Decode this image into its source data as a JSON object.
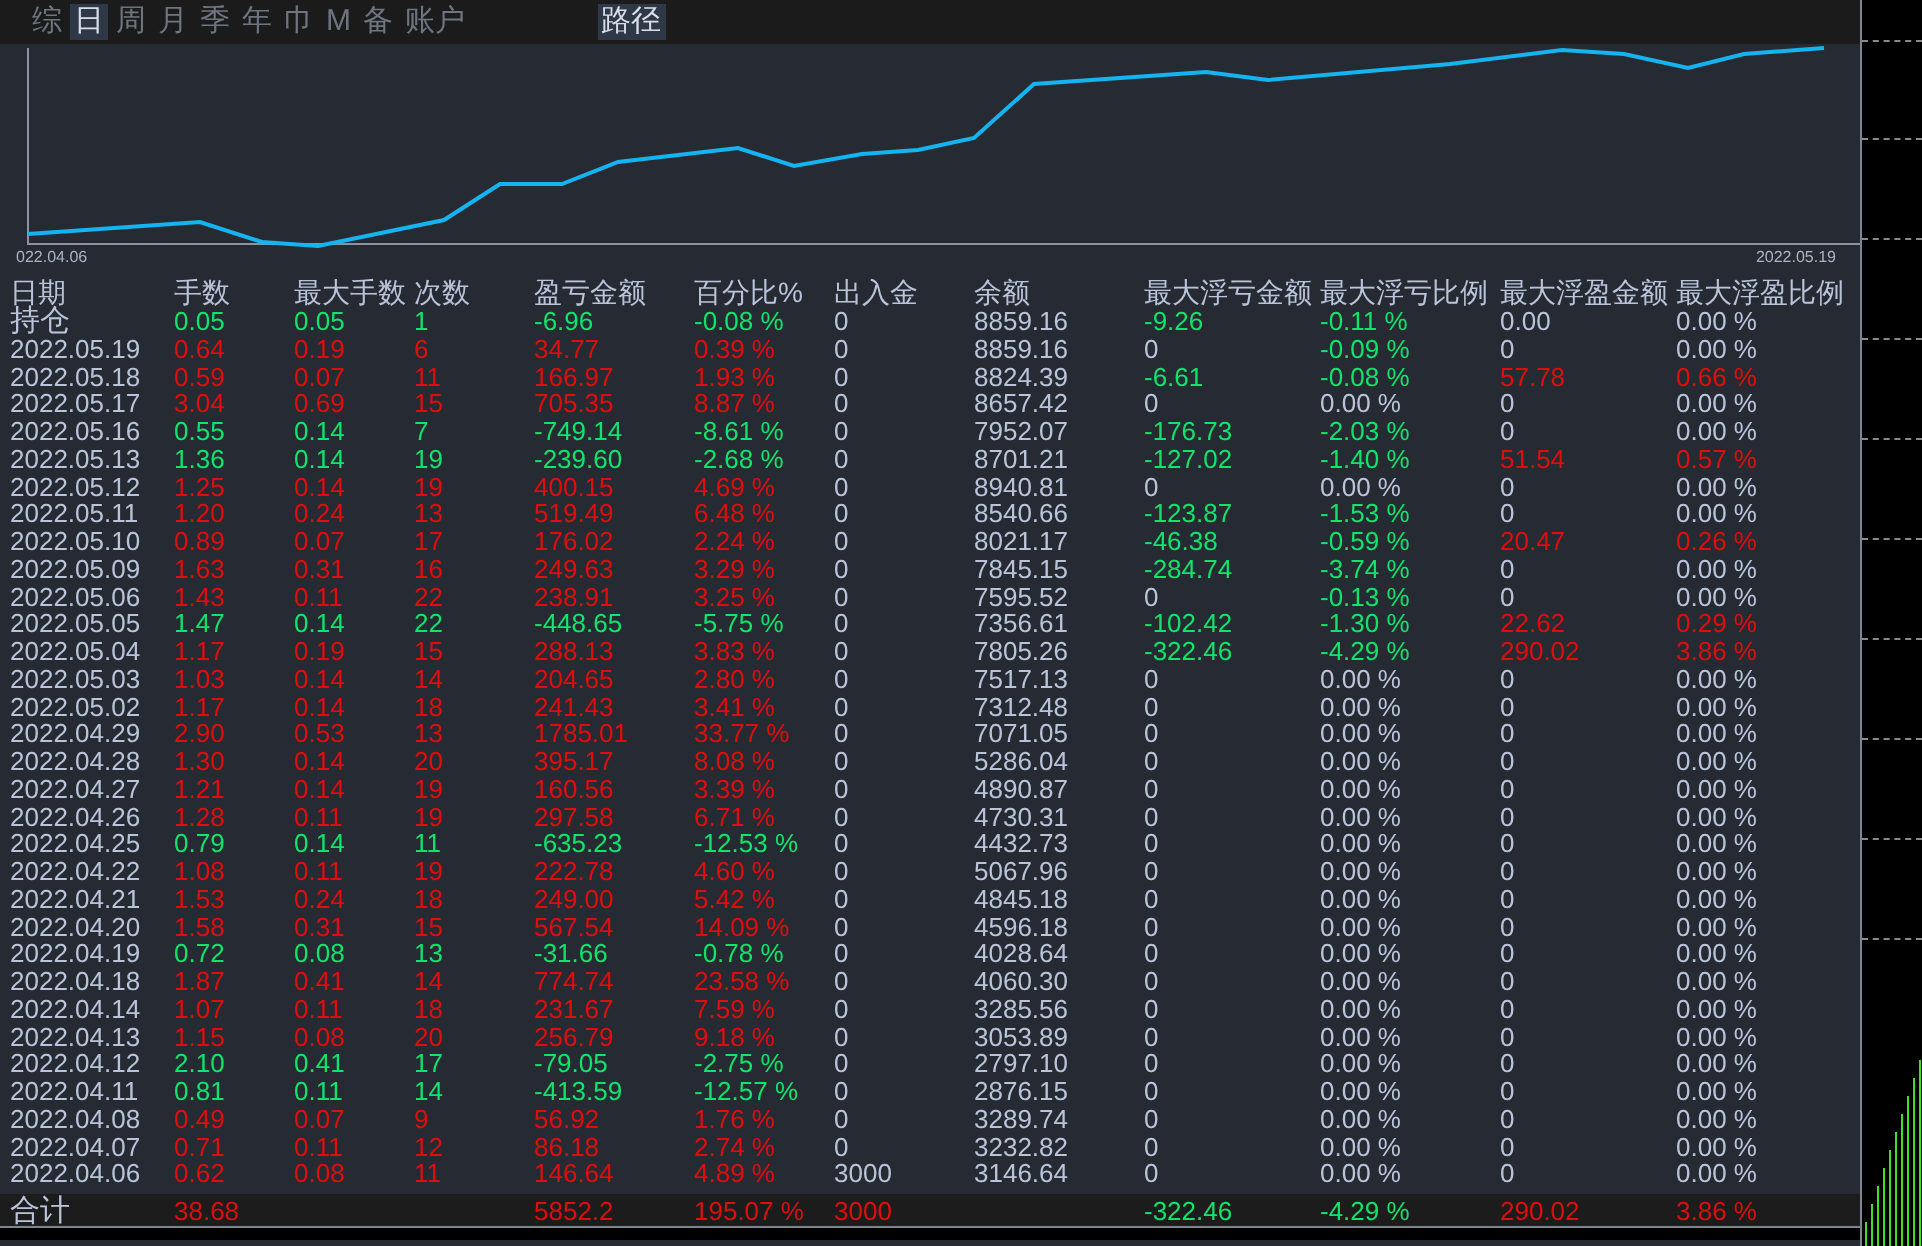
{
  "tabs": [
    {
      "label": "综",
      "selected": false
    },
    {
      "label": "日",
      "selected": true
    },
    {
      "label": "周",
      "selected": false
    },
    {
      "label": "月",
      "selected": false
    },
    {
      "label": "季",
      "selected": false
    },
    {
      "label": "年",
      "selected": false
    },
    {
      "label": "巾",
      "selected": false
    },
    {
      "label": "M",
      "selected": false
    },
    {
      "label": "备",
      "selected": false
    },
    {
      "label": "账户",
      "selected": false
    }
  ],
  "path_tab": {
    "label": "路径",
    "selected": true
  },
  "chart": {
    "start_label": "022.04.06",
    "end_label": "2022.05.19"
  },
  "table": {
    "columns": [
      "日期",
      "手数",
      "最大手数",
      "次数",
      "盈亏金额",
      "百分比%",
      "出入金",
      "余额",
      "最大浮亏金额",
      "最大浮亏比例",
      "最大浮盈金额",
      "最大浮盈比例"
    ],
    "rows": [
      {
        "kind": "position",
        "date": "持仓",
        "color": "#11e46a",
        "lots": "0.05",
        "max_lots": "0.05",
        "count": "1",
        "pnl": "-6.96",
        "percent": "-0.08 %",
        "transfer": "0",
        "balance": "8859.16",
        "float": [
          {
            "text": "-9.26",
            "color": "#11e46a"
          },
          {
            "text": "-0.11 %",
            "color": "#11e46a"
          },
          {
            "text": "0.00",
            "color": "#b9c4da"
          },
          {
            "text": "0.00 %",
            "color": "#b9c4da"
          }
        ]
      },
      {
        "kind": "day",
        "date": "2022.05.19",
        "color": "#e00d0d",
        "lots": "0.64",
        "max_lots": "0.19",
        "count": "6",
        "pnl": "34.77",
        "percent": "0.39 %",
        "transfer": "0",
        "balance": "8859.16",
        "float": [
          {
            "text": "0",
            "color": "#b9c4da"
          },
          {
            "text": "-0.09 %",
            "color": "#11e46a"
          },
          {
            "text": "0",
            "color": "#b9c4da"
          },
          {
            "text": "0.00 %",
            "color": "#b9c4da"
          }
        ]
      },
      {
        "kind": "day",
        "date": "2022.05.18",
        "color": "#e00d0d",
        "lots": "0.59",
        "max_lots": "0.07",
        "count": "11",
        "pnl": "166.97",
        "percent": "1.93 %",
        "transfer": "0",
        "balance": "8824.39",
        "float": [
          {
            "text": "-6.61",
            "color": "#11e46a"
          },
          {
            "text": "-0.08 %",
            "color": "#11e46a"
          },
          {
            "text": "57.78",
            "color": "#e00d0d"
          },
          {
            "text": "0.66 %",
            "color": "#e00d0d"
          }
        ]
      },
      {
        "kind": "day",
        "date": "2022.05.17",
        "color": "#e00d0d",
        "lots": "3.04",
        "max_lots": "0.69",
        "count": "15",
        "pnl": "705.35",
        "percent": "8.87 %",
        "transfer": "0",
        "balance": "8657.42",
        "float": [
          {
            "text": "0",
            "color": "#b9c4da"
          },
          {
            "text": "0.00 %",
            "color": "#b9c4da"
          },
          {
            "text": "0",
            "color": "#b9c4da"
          },
          {
            "text": "0.00 %",
            "color": "#b9c4da"
          }
        ]
      },
      {
        "kind": "day",
        "date": "2022.05.16",
        "color": "#11e46a",
        "lots": "0.55",
        "max_lots": "0.14",
        "count": "7",
        "pnl": "-749.14",
        "percent": "-8.61 %",
        "transfer": "0",
        "balance": "7952.07",
        "float": [
          {
            "text": "-176.73",
            "color": "#11e46a"
          },
          {
            "text": "-2.03 %",
            "color": "#11e46a"
          },
          {
            "text": "0",
            "color": "#b9c4da"
          },
          {
            "text": "0.00 %",
            "color": "#b9c4da"
          }
        ]
      },
      {
        "kind": "day",
        "date": "2022.05.13",
        "color": "#11e46a",
        "lots": "1.36",
        "max_lots": "0.14",
        "count": "19",
        "pnl": "-239.60",
        "percent": "-2.68 %",
        "transfer": "0",
        "balance": "8701.21",
        "float": [
          {
            "text": "-127.02",
            "color": "#11e46a"
          },
          {
            "text": "-1.40 %",
            "color": "#11e46a"
          },
          {
            "text": "51.54",
            "color": "#e00d0d"
          },
          {
            "text": "0.57 %",
            "color": "#e00d0d"
          }
        ]
      },
      {
        "kind": "day",
        "date": "2022.05.12",
        "color": "#e00d0d",
        "lots": "1.25",
        "max_lots": "0.14",
        "count": "19",
        "pnl": "400.15",
        "percent": "4.69 %",
        "transfer": "0",
        "balance": "8940.81",
        "float": [
          {
            "text": "0",
            "color": "#b9c4da"
          },
          {
            "text": "0.00 %",
            "color": "#b9c4da"
          },
          {
            "text": "0",
            "color": "#b9c4da"
          },
          {
            "text": "0.00 %",
            "color": "#b9c4da"
          }
        ]
      },
      {
        "kind": "day",
        "date": "2022.05.11",
        "color": "#e00d0d",
        "lots": "1.20",
        "max_lots": "0.24",
        "count": "13",
        "pnl": "519.49",
        "percent": "6.48 %",
        "transfer": "0",
        "balance": "8540.66",
        "float": [
          {
            "text": "-123.87",
            "color": "#11e46a"
          },
          {
            "text": "-1.53 %",
            "color": "#11e46a"
          },
          {
            "text": "0",
            "color": "#b9c4da"
          },
          {
            "text": "0.00 %",
            "color": "#b9c4da"
          }
        ]
      },
      {
        "kind": "day",
        "date": "2022.05.10",
        "color": "#e00d0d",
        "lots": "0.89",
        "max_lots": "0.07",
        "count": "17",
        "pnl": "176.02",
        "percent": "2.24 %",
        "transfer": "0",
        "balance": "8021.17",
        "float": [
          {
            "text": "-46.38",
            "color": "#11e46a"
          },
          {
            "text": "-0.59 %",
            "color": "#11e46a"
          },
          {
            "text": "20.47",
            "color": "#e00d0d"
          },
          {
            "text": "0.26 %",
            "color": "#e00d0d"
          }
        ]
      },
      {
        "kind": "day",
        "date": "2022.05.09",
        "color": "#e00d0d",
        "lots": "1.63",
        "max_lots": "0.31",
        "count": "16",
        "pnl": "249.63",
        "percent": "3.29 %",
        "transfer": "0",
        "balance": "7845.15",
        "float": [
          {
            "text": "-284.74",
            "color": "#11e46a"
          },
          {
            "text": "-3.74 %",
            "color": "#11e46a"
          },
          {
            "text": "0",
            "color": "#b9c4da"
          },
          {
            "text": "0.00 %",
            "color": "#b9c4da"
          }
        ]
      },
      {
        "kind": "day",
        "date": "2022.05.06",
        "color": "#e00d0d",
        "lots": "1.43",
        "max_lots": "0.11",
        "count": "22",
        "pnl": "238.91",
        "percent": "3.25 %",
        "transfer": "0",
        "balance": "7595.52",
        "float": [
          {
            "text": "0",
            "color": "#b9c4da"
          },
          {
            "text": "-0.13 %",
            "color": "#11e46a"
          },
          {
            "text": "0",
            "color": "#b9c4da"
          },
          {
            "text": "0.00 %",
            "color": "#b9c4da"
          }
        ]
      },
      {
        "kind": "day",
        "date": "2022.05.05",
        "color": "#11e46a",
        "lots": "1.47",
        "max_lots": "0.14",
        "count": "22",
        "pnl": "-448.65",
        "percent": "-5.75 %",
        "transfer": "0",
        "balance": "7356.61",
        "float": [
          {
            "text": "-102.42",
            "color": "#11e46a"
          },
          {
            "text": "-1.30 %",
            "color": "#11e46a"
          },
          {
            "text": "22.62",
            "color": "#e00d0d"
          },
          {
            "text": "0.29 %",
            "color": "#e00d0d"
          }
        ]
      },
      {
        "kind": "day",
        "date": "2022.05.04",
        "color": "#e00d0d",
        "lots": "1.17",
        "max_lots": "0.19",
        "count": "15",
        "pnl": "288.13",
        "percent": "3.83 %",
        "transfer": "0",
        "balance": "7805.26",
        "float": [
          {
            "text": "-322.46",
            "color": "#11e46a"
          },
          {
            "text": "-4.29 %",
            "color": "#11e46a"
          },
          {
            "text": "290.02",
            "color": "#e00d0d"
          },
          {
            "text": "3.86 %",
            "color": "#e00d0d"
          }
        ]
      },
      {
        "kind": "day",
        "date": "2022.05.03",
        "color": "#e00d0d",
        "lots": "1.03",
        "max_lots": "0.14",
        "count": "14",
        "pnl": "204.65",
        "percent": "2.80 %",
        "transfer": "0",
        "balance": "7517.13",
        "float": [
          {
            "text": "0",
            "color": "#b9c4da"
          },
          {
            "text": "0.00 %",
            "color": "#b9c4da"
          },
          {
            "text": "0",
            "color": "#b9c4da"
          },
          {
            "text": "0.00 %",
            "color": "#b9c4da"
          }
        ]
      },
      {
        "kind": "day",
        "date": "2022.05.02",
        "color": "#e00d0d",
        "lots": "1.17",
        "max_lots": "0.14",
        "count": "18",
        "pnl": "241.43",
        "percent": "3.41 %",
        "transfer": "0",
        "balance": "7312.48",
        "float": [
          {
            "text": "0",
            "color": "#b9c4da"
          },
          {
            "text": "0.00 %",
            "color": "#b9c4da"
          },
          {
            "text": "0",
            "color": "#b9c4da"
          },
          {
            "text": "0.00 %",
            "color": "#b9c4da"
          }
        ]
      },
      {
        "kind": "day",
        "date": "2022.04.29",
        "color": "#e00d0d",
        "lots": "2.90",
        "max_lots": "0.53",
        "count": "13",
        "pnl": "1785.01",
        "percent": "33.77 %",
        "transfer": "0",
        "balance": "7071.05",
        "float": [
          {
            "text": "0",
            "color": "#b9c4da"
          },
          {
            "text": "0.00 %",
            "color": "#b9c4da"
          },
          {
            "text": "0",
            "color": "#b9c4da"
          },
          {
            "text": "0.00 %",
            "color": "#b9c4da"
          }
        ]
      },
      {
        "kind": "day",
        "date": "2022.04.28",
        "color": "#e00d0d",
        "lots": "1.30",
        "max_lots": "0.14",
        "count": "20",
        "pnl": "395.17",
        "percent": "8.08 %",
        "transfer": "0",
        "balance": "5286.04",
        "float": [
          {
            "text": "0",
            "color": "#b9c4da"
          },
          {
            "text": "0.00 %",
            "color": "#b9c4da"
          },
          {
            "text": "0",
            "color": "#b9c4da"
          },
          {
            "text": "0.00 %",
            "color": "#b9c4da"
          }
        ]
      },
      {
        "kind": "day",
        "date": "2022.04.27",
        "color": "#e00d0d",
        "lots": "1.21",
        "max_lots": "0.14",
        "count": "19",
        "pnl": "160.56",
        "percent": "3.39 %",
        "transfer": "0",
        "balance": "4890.87",
        "float": [
          {
            "text": "0",
            "color": "#b9c4da"
          },
          {
            "text": "0.00 %",
            "color": "#b9c4da"
          },
          {
            "text": "0",
            "color": "#b9c4da"
          },
          {
            "text": "0.00 %",
            "color": "#b9c4da"
          }
        ]
      },
      {
        "kind": "day",
        "date": "2022.04.26",
        "color": "#e00d0d",
        "lots": "1.28",
        "max_lots": "0.11",
        "count": "19",
        "pnl": "297.58",
        "percent": "6.71 %",
        "transfer": "0",
        "balance": "4730.31",
        "float": [
          {
            "text": "0",
            "color": "#b9c4da"
          },
          {
            "text": "0.00 %",
            "color": "#b9c4da"
          },
          {
            "text": "0",
            "color": "#b9c4da"
          },
          {
            "text": "0.00 %",
            "color": "#b9c4da"
          }
        ]
      },
      {
        "kind": "day",
        "date": "2022.04.25",
        "color": "#11e46a",
        "lots": "0.79",
        "max_lots": "0.14",
        "count": "11",
        "pnl": "-635.23",
        "percent": "-12.53 %",
        "transfer": "0",
        "balance": "4432.73",
        "float": [
          {
            "text": "0",
            "color": "#b9c4da"
          },
          {
            "text": "0.00 %",
            "color": "#b9c4da"
          },
          {
            "text": "0",
            "color": "#b9c4da"
          },
          {
            "text": "0.00 %",
            "color": "#b9c4da"
          }
        ]
      },
      {
        "kind": "day",
        "date": "2022.04.22",
        "color": "#e00d0d",
        "lots": "1.08",
        "max_lots": "0.11",
        "count": "19",
        "pnl": "222.78",
        "percent": "4.60 %",
        "transfer": "0",
        "balance": "5067.96",
        "float": [
          {
            "text": "0",
            "color": "#b9c4da"
          },
          {
            "text": "0.00 %",
            "color": "#b9c4da"
          },
          {
            "text": "0",
            "color": "#b9c4da"
          },
          {
            "text": "0.00 %",
            "color": "#b9c4da"
          }
        ]
      },
      {
        "kind": "day",
        "date": "2022.04.21",
        "color": "#e00d0d",
        "lots": "1.53",
        "max_lots": "0.24",
        "count": "18",
        "pnl": "249.00",
        "percent": "5.42 %",
        "transfer": "0",
        "balance": "4845.18",
        "float": [
          {
            "text": "0",
            "color": "#b9c4da"
          },
          {
            "text": "0.00 %",
            "color": "#b9c4da"
          },
          {
            "text": "0",
            "color": "#b9c4da"
          },
          {
            "text": "0.00 %",
            "color": "#b9c4da"
          }
        ]
      },
      {
        "kind": "day",
        "date": "2022.04.20",
        "color": "#e00d0d",
        "lots": "1.58",
        "max_lots": "0.31",
        "count": "15",
        "pnl": "567.54",
        "percent": "14.09 %",
        "transfer": "0",
        "balance": "4596.18",
        "float": [
          {
            "text": "0",
            "color": "#b9c4da"
          },
          {
            "text": "0.00 %",
            "color": "#b9c4da"
          },
          {
            "text": "0",
            "color": "#b9c4da"
          },
          {
            "text": "0.00 %",
            "color": "#b9c4da"
          }
        ]
      },
      {
        "kind": "day",
        "date": "2022.04.19",
        "color": "#11e46a",
        "lots": "0.72",
        "max_lots": "0.08",
        "count": "13",
        "pnl": "-31.66",
        "percent": "-0.78 %",
        "transfer": "0",
        "balance": "4028.64",
        "float": [
          {
            "text": "0",
            "color": "#b9c4da"
          },
          {
            "text": "0.00 %",
            "color": "#b9c4da"
          },
          {
            "text": "0",
            "color": "#b9c4da"
          },
          {
            "text": "0.00 %",
            "color": "#b9c4da"
          }
        ]
      },
      {
        "kind": "day",
        "date": "2022.04.18",
        "color": "#e00d0d",
        "lots": "1.87",
        "max_lots": "0.41",
        "count": "14",
        "pnl": "774.74",
        "percent": "23.58 %",
        "transfer": "0",
        "balance": "4060.30",
        "float": [
          {
            "text": "0",
            "color": "#b9c4da"
          },
          {
            "text": "0.00 %",
            "color": "#b9c4da"
          },
          {
            "text": "0",
            "color": "#b9c4da"
          },
          {
            "text": "0.00 %",
            "color": "#b9c4da"
          }
        ]
      },
      {
        "kind": "day",
        "date": "2022.04.14",
        "color": "#e00d0d",
        "lots": "1.07",
        "max_lots": "0.11",
        "count": "18",
        "pnl": "231.67",
        "percent": "7.59 %",
        "transfer": "0",
        "balance": "3285.56",
        "float": [
          {
            "text": "0",
            "color": "#b9c4da"
          },
          {
            "text": "0.00 %",
            "color": "#b9c4da"
          },
          {
            "text": "0",
            "color": "#b9c4da"
          },
          {
            "text": "0.00 %",
            "color": "#b9c4da"
          }
        ]
      },
      {
        "kind": "day",
        "date": "2022.04.13",
        "color": "#e00d0d",
        "lots": "1.15",
        "max_lots": "0.08",
        "count": "20",
        "pnl": "256.79",
        "percent": "9.18 %",
        "transfer": "0",
        "balance": "3053.89",
        "float": [
          {
            "text": "0",
            "color": "#b9c4da"
          },
          {
            "text": "0.00 %",
            "color": "#b9c4da"
          },
          {
            "text": "0",
            "color": "#b9c4da"
          },
          {
            "text": "0.00 %",
            "color": "#b9c4da"
          }
        ]
      },
      {
        "kind": "day",
        "date": "2022.04.12",
        "color": "#11e46a",
        "lots": "2.10",
        "max_lots": "0.41",
        "count": "17",
        "pnl": "-79.05",
        "percent": "-2.75 %",
        "transfer": "0",
        "balance": "2797.10",
        "float": [
          {
            "text": "0",
            "color": "#b9c4da"
          },
          {
            "text": "0.00 %",
            "color": "#b9c4da"
          },
          {
            "text": "0",
            "color": "#b9c4da"
          },
          {
            "text": "0.00 %",
            "color": "#b9c4da"
          }
        ]
      },
      {
        "kind": "day",
        "date": "2022.04.11",
        "color": "#11e46a",
        "lots": "0.81",
        "max_lots": "0.11",
        "count": "14",
        "pnl": "-413.59",
        "percent": "-12.57 %",
        "transfer": "0",
        "balance": "2876.15",
        "float": [
          {
            "text": "0",
            "color": "#b9c4da"
          },
          {
            "text": "0.00 %",
            "color": "#b9c4da"
          },
          {
            "text": "0",
            "color": "#b9c4da"
          },
          {
            "text": "0.00 %",
            "color": "#b9c4da"
          }
        ]
      },
      {
        "kind": "day",
        "date": "2022.04.08",
        "color": "#e00d0d",
        "lots": "0.49",
        "max_lots": "0.07",
        "count": "9",
        "pnl": "56.92",
        "percent": "1.76 %",
        "transfer": "0",
        "balance": "3289.74",
        "float": [
          {
            "text": "0",
            "color": "#b9c4da"
          },
          {
            "text": "0.00 %",
            "color": "#b9c4da"
          },
          {
            "text": "0",
            "color": "#b9c4da"
          },
          {
            "text": "0.00 %",
            "color": "#b9c4da"
          }
        ]
      },
      {
        "kind": "day",
        "date": "2022.04.07",
        "color": "#e00d0d",
        "lots": "0.71",
        "max_lots": "0.11",
        "count": "12",
        "pnl": "86.18",
        "percent": "2.74 %",
        "transfer": "0",
        "balance": "3232.82",
        "float": [
          {
            "text": "0",
            "color": "#b9c4da"
          },
          {
            "text": "0.00 %",
            "color": "#b9c4da"
          },
          {
            "text": "0",
            "color": "#b9c4da"
          },
          {
            "text": "0.00 %",
            "color": "#b9c4da"
          }
        ]
      },
      {
        "kind": "day",
        "date": "2022.04.06",
        "color": "#e00d0d",
        "lots": "0.62",
        "max_lots": "0.08",
        "count": "11",
        "pnl": "146.64",
        "percent": "4.89 %",
        "transfer": "3000",
        "balance": "3146.64",
        "float": [
          {
            "text": "0",
            "color": "#b9c4da"
          },
          {
            "text": "0.00 %",
            "color": "#b9c4da"
          },
          {
            "text": "0",
            "color": "#b9c4da"
          },
          {
            "text": "0.00 %",
            "color": "#b9c4da"
          }
        ]
      }
    ],
    "total": {
      "label": "合计",
      "lots": {
        "text": "38.68",
        "color": "#e00d0d"
      },
      "pnl": {
        "text": "5852.2",
        "color": "#e00d0d"
      },
      "percent": {
        "text": "195.07 %",
        "color": "#e00d0d"
      },
      "transfer": {
        "text": "3000",
        "color": "#e00d0d"
      },
      "max_float_loss": {
        "text": "-322.46",
        "color": "#11e46a"
      },
      "max_float_loss_pct": {
        "text": "-4.29 %",
        "color": "#11e46a"
      },
      "max_float_profit": {
        "text": "290.02",
        "color": "#e00d0d"
      },
      "max_float_profit_pct": {
        "text": "3.86 %",
        "color": "#e00d0d"
      }
    }
  }
}
